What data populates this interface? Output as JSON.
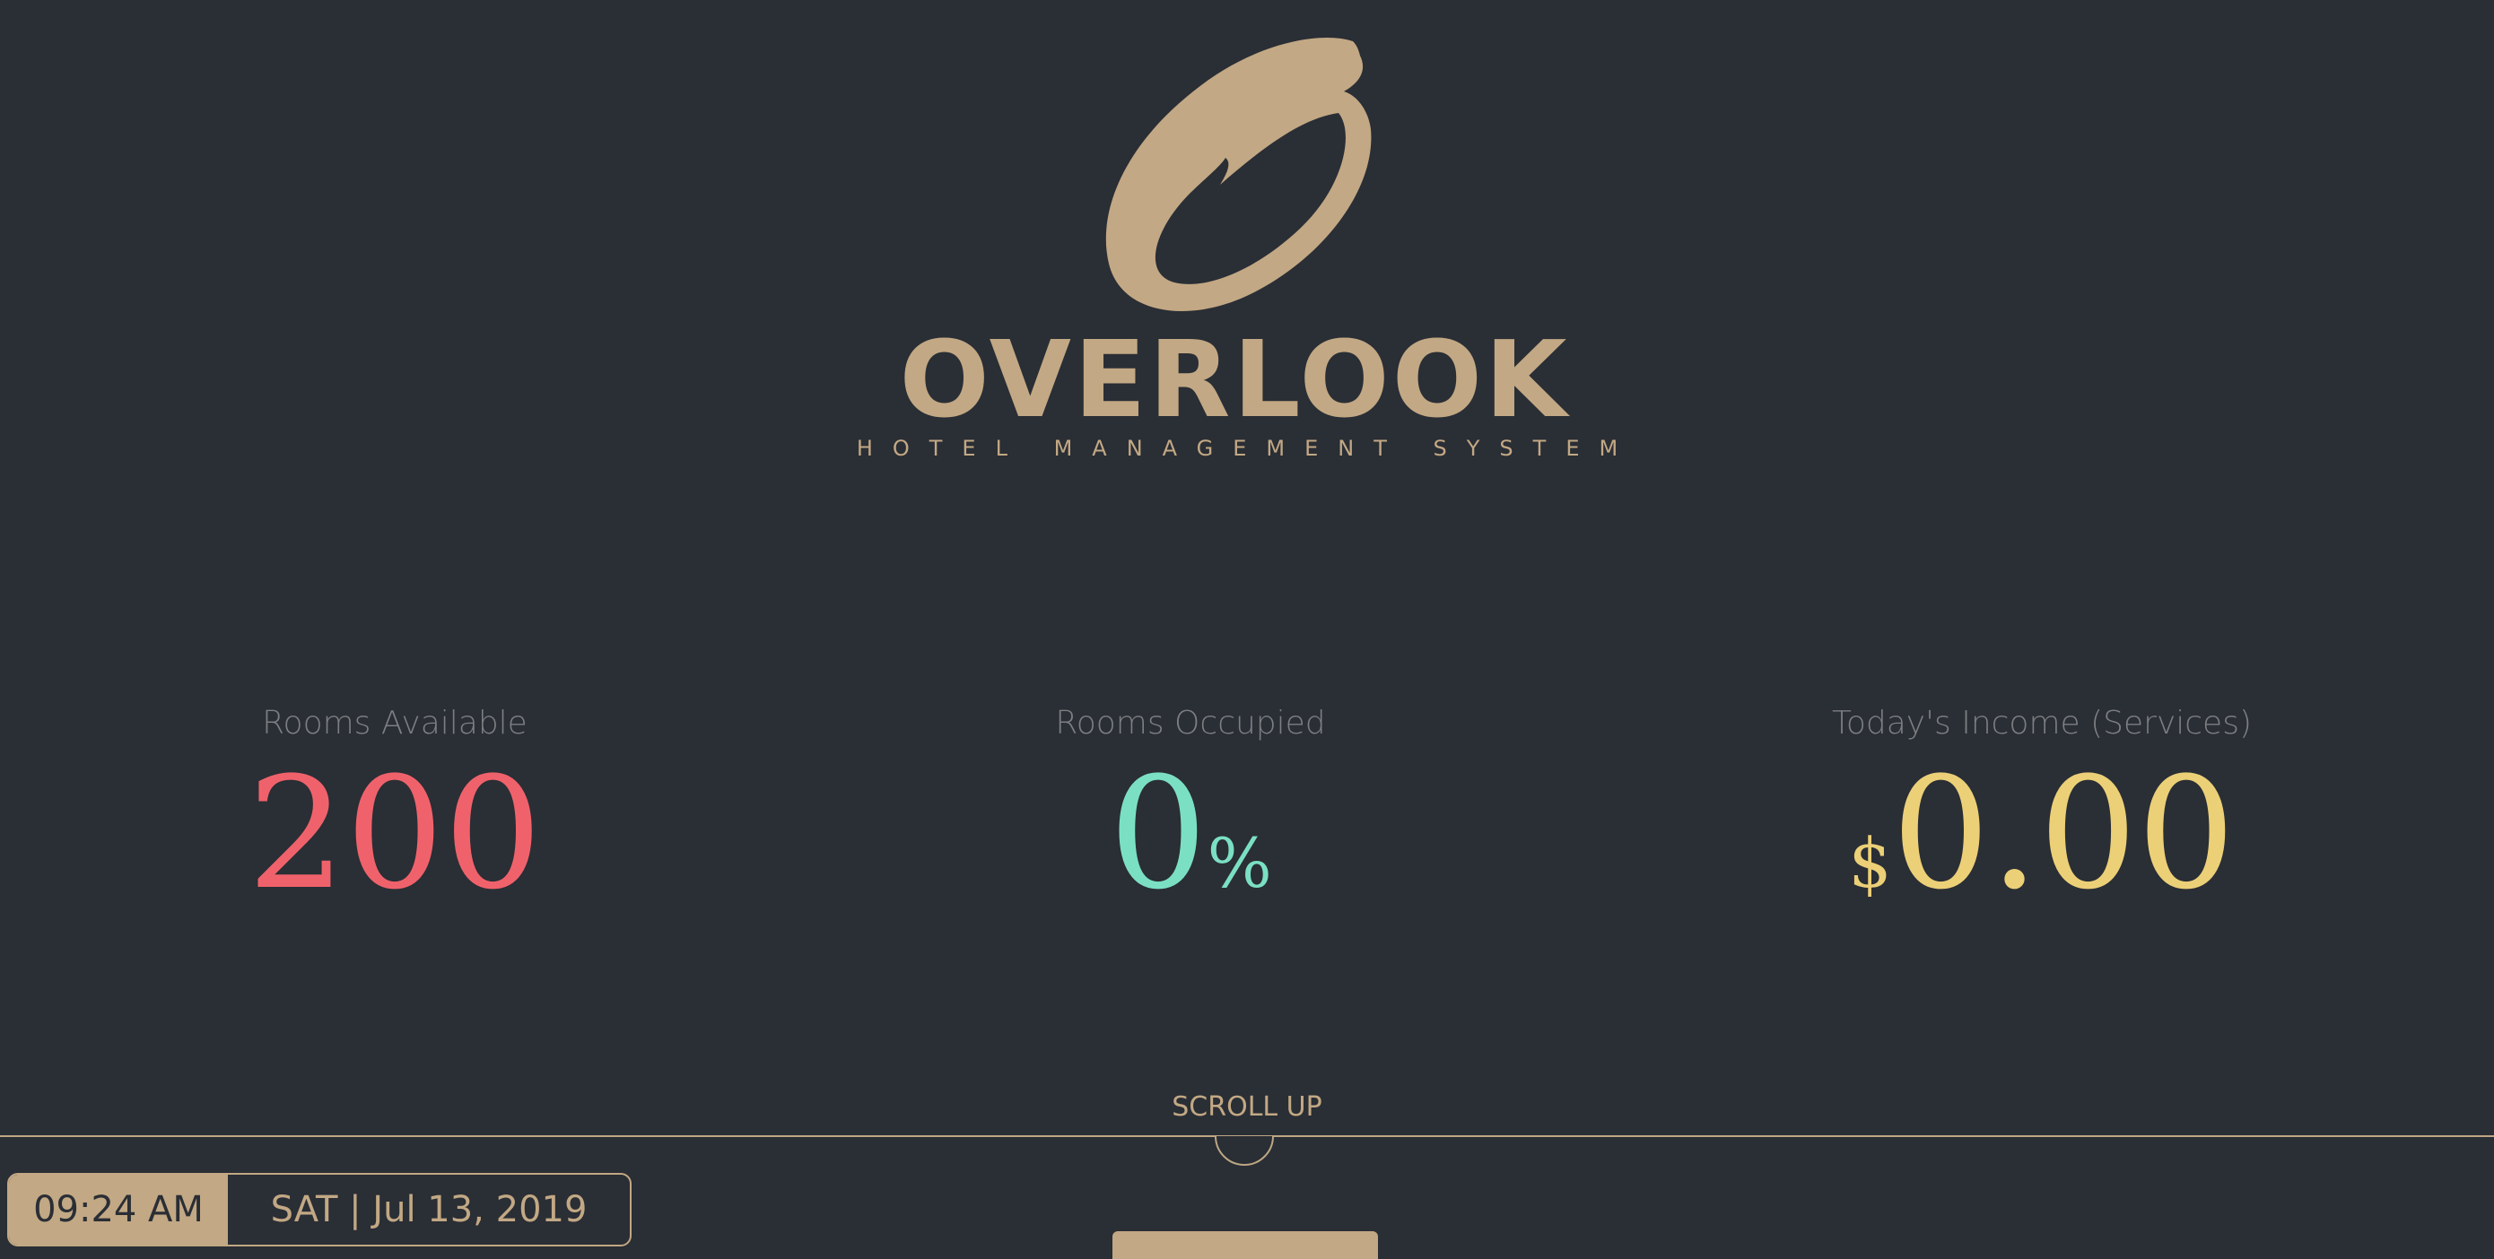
{
  "brand": {
    "name": "OVERLOOK",
    "subtitle": "HOTEL MANAGEMENT SYSTEM"
  },
  "stats": {
    "rooms_available": {
      "label": "Rooms Available",
      "value": "200",
      "color": "#f0626b"
    },
    "rooms_occupied": {
      "label": "Rooms Occupied",
      "value": "0",
      "unit": "%",
      "color": "#7be0c3"
    },
    "todays_income": {
      "label": "Today's Income (Services)",
      "currency": "$",
      "value": "0.00",
      "color": "#ecd077"
    }
  },
  "scroll": {
    "label": "SCROLL UP"
  },
  "clock": {
    "time": "09:24 AM",
    "date": "SAT | Jul 13, 2019"
  },
  "colors": {
    "background": "#2a2e35",
    "accent": "#c2a884",
    "label": "#7d7f82"
  }
}
